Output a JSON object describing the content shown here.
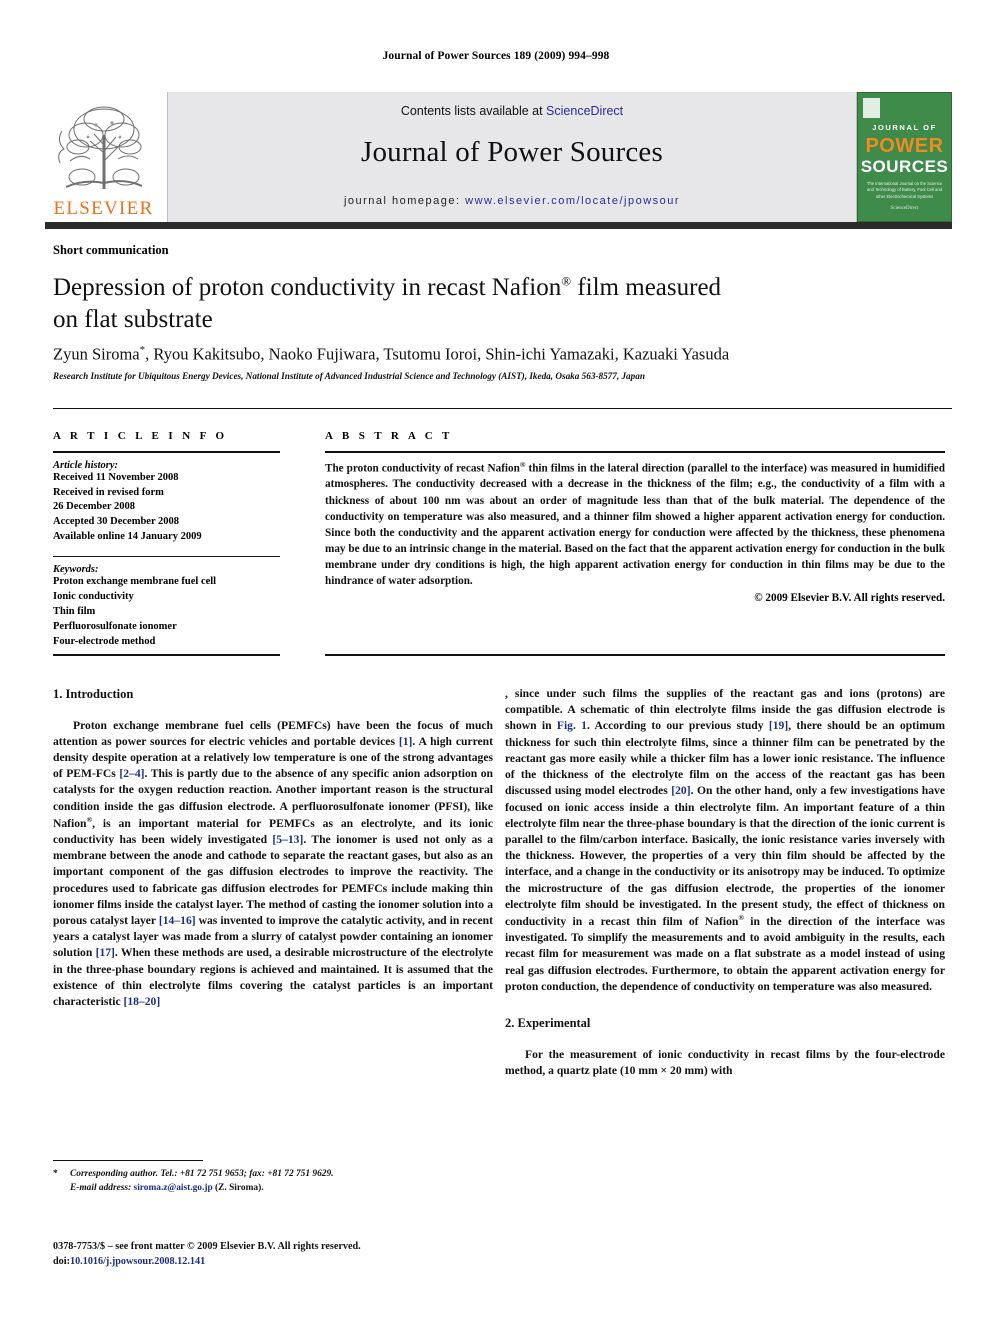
{
  "running_head": "Journal of Power Sources 189 (2009) 994–998",
  "masthead": {
    "publisher_name": "ELSEVIER",
    "contents_prefix": "Contents lists available at ",
    "contents_link": "ScienceDirect",
    "journal_name": "Journal of Power Sources",
    "homepage_prefix": "journal homepage: ",
    "homepage_url": "www.elsevier.com/locate/jpowsour",
    "cover": {
      "line1": "JOURNAL OF",
      "line2": "POWER",
      "line3": "SOURCES",
      "subtitle": "The International Journal on the Science and Technology of Battery, Fuel Cell and other Electrochemical Systems",
      "footer": "ScienceDirect",
      "bg_color": "#3e8b4a",
      "accent_color": "#F18A21"
    }
  },
  "article": {
    "type": "Short communication",
    "title_line1": "Depression of proton conductivity in recast Nafion",
    "title_sup": "®",
    "title_line1_end": " film measured",
    "title_line2": "on flat substrate",
    "authors": "Zyun Siroma",
    "authors_star": "*",
    "authors_rest": ", Ryou Kakitsubo, Naoko Fujiwara, Tsutomu Ioroi, Shin-ichi Yamazaki, Kazuaki Yasuda",
    "affiliation": "Research Institute for Ubiquitous Energy Devices, National Institute of Advanced Industrial Science and Technology (AIST), Ikeda, Osaka 563-8577, Japan"
  },
  "article_info": {
    "heading": "A R T I C L E   I N F O",
    "history_label": "Article history:",
    "history": [
      "Received 11 November 2008",
      "Received in revised form",
      "26 December 2008",
      "Accepted 30 December 2008",
      "Available online 14 January 2009"
    ],
    "keywords_label": "Keywords:",
    "keywords": [
      "Proton exchange membrane fuel cell",
      "Ionic conductivity",
      "Thin film",
      "Perfluorosulfonate ionomer",
      "Four-electrode method"
    ]
  },
  "abstract": {
    "heading": "A B S T R A C T",
    "part1": "The proton conductivity of recast Nafion",
    "sup": "®",
    "part2": " thin films in the lateral direction (parallel to the interface) was measured in humidified atmospheres. The conductivity decreased with a decrease in the thickness of the film; e.g., the conductivity of a film with a thickness of about 100 nm was about an order of magnitude less than that of the bulk material. The dependence of the conductivity on temperature was also measured, and a thinner film showed a higher apparent activation energy for conduction. Since both the conductivity and the apparent activation energy for conduction were affected by the thickness, these phenomena may be due to an intrinsic change in the material. Based on the fact that the apparent activation energy for conduction in the bulk membrane under dry conditions is high, the high apparent activation energy for conduction in thin films may be due to the hindrance of water adsorption.",
    "copyright": "© 2009 Elsevier B.V. All rights reserved."
  },
  "sections": {
    "intro_heading": "1.  Introduction",
    "intro_p1_a": "Proton exchange membrane fuel cells (PEMFCs) have been the focus of much attention as power sources for electric vehicles and portable devices ",
    "ref1": "[1]",
    "intro_p1_b": ". A high current density despite operation at a relatively low temperature is one of the strong advantages of PEM-FCs ",
    "ref2": "[2–4]",
    "intro_p1_c": ". This is partly due to the absence of any specific anion adsorption on catalysts for the oxygen reduction reaction. Another important reason is the structural condition inside the gas diffusion electrode. A perfluorosulfonate ionomer (PFSI), like Nafion",
    "sup_reg": "®",
    "intro_p1_d": ", is an important material for PEMFCs as an electrolyte, and its ionic conductivity has been widely investigated ",
    "ref3": "[5–13]",
    "intro_p1_e": ". The ionomer is used not only as a membrane between the anode and cathode to separate the reactant gases, but also as an important component of the gas diffusion electrodes to improve the reactivity. The procedures used to fabricate gas diffusion electrodes for PEMFCs include making thin ionomer films inside the catalyst layer. The method of casting the ionomer solution into a porous catalyst layer ",
    "ref4": "[14–16]",
    "intro_p1_f": " was invented to improve the catalytic activity, and in recent years a catalyst layer was made from a slurry of catalyst powder containing an ionomer solution ",
    "ref5": "[17]",
    "intro_p1_g": ". When these methods are used, a desirable microstructure of the electrolyte in the three-phase boundary regions is achieved and maintained. It is assumed that the existence of thin electrolyte films covering the catalyst particles is an important characteristic ",
    "ref6": "[18–20]",
    "intro_p1_h": ", since under such films the supplies of the reactant gas and ions (protons) are compatible. A schematic of thin electrolyte films inside the gas diffusion electrode is shown in ",
    "figref": "Fig. 1",
    "intro_p1_i": ". According to our previous study ",
    "ref7": "[19]",
    "intro_p1_j": ", there should be an optimum thickness for such thin electrolyte films, since a thinner film can be penetrated by the reactant gas more easily while a thicker film has a lower ionic resistance. The influence of the thickness of the electrolyte film on the access of the reactant gas has been discussed using model electrodes ",
    "ref8": "[20]",
    "intro_p1_k": ". On the other hand, only a few investigations have focused on ionic access inside a thin electrolyte film. An important feature of a thin electrolyte film near the three-phase boundary is that the direction of the ionic current is parallel to the film/carbon interface. Basically, the ionic resistance varies inversely with the thickness. However, the properties of a very thin film should be affected by the interface, and a change in the conductivity or its anisotropy may be induced. To optimize the microstructure of the gas diffusion electrode, the properties of the ionomer electrolyte film should be investigated. In the present study, the effect of thickness on conductivity in a recast thin film of Nafion",
    "intro_p1_l": " in the direction of the interface was investigated. To simplify the measurements and to avoid ambiguity in the results, each recast film for measurement was made on a flat substrate as a model instead of using real gas diffusion electrodes. Furthermore, to obtain the apparent activation energy for proton conduction, the dependence of conductivity on temperature was also measured.",
    "exp_heading": "2.  Experimental",
    "exp_p1": "For the measurement of ionic conductivity in recast films by the four-electrode method, a quartz plate (10 mm × 20 mm) with"
  },
  "footnote": {
    "star": "*",
    "corresponding": "Corresponding author. Tel.: +81 72 751 9653; fax: +81 72 751 9629.",
    "email_label": "E-mail address:",
    "email": "siroma.z@aist.go.jp",
    "email_suffix": " (Z. Siroma).",
    "issn_line": "0378-7753/$ – see front matter © 2009 Elsevier B.V. All rights reserved.",
    "doi_label": "doi:",
    "doi": "10.1016/j.jpowsour.2008.12.141"
  },
  "colors": {
    "link": "#1b2f8a",
    "elsevier_orange": "#E9711C",
    "masthead_bg": "#e7e7e9"
  }
}
